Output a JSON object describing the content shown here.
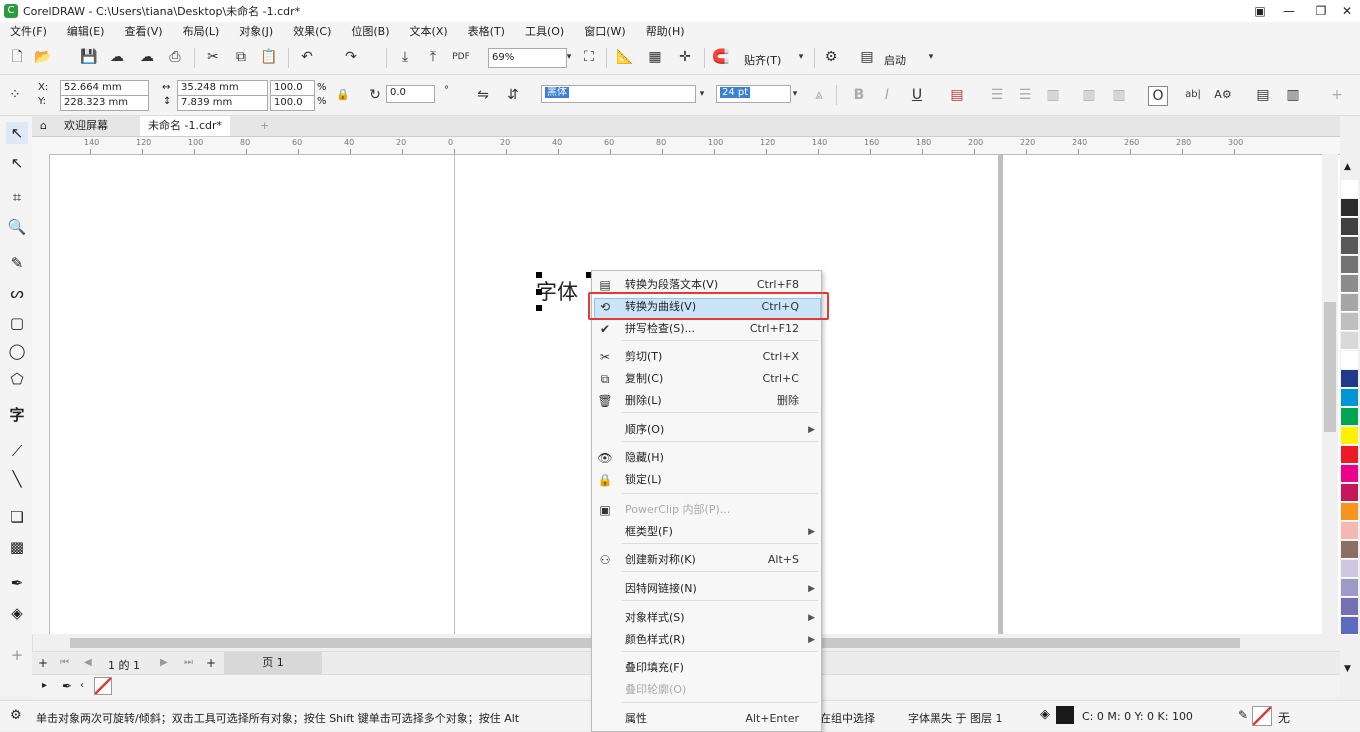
{
  "window": {
    "title": "CorelDRAW - C:\\Users\\tiana\\Desktop\\未命名 -1.cdr*"
  },
  "menu": [
    "文件(F)",
    "编辑(E)",
    "查看(V)",
    "布局(L)",
    "对象(J)",
    "效果(C)",
    "位图(B)",
    "文本(X)",
    "表格(T)",
    "工具(O)",
    "窗口(W)",
    "帮助(H)"
  ],
  "toolbar": {
    "zoom": "69%",
    "snap_label": "贴齐(T)",
    "launch_label": "启动"
  },
  "props": {
    "x_label": "X:",
    "x": "52.664 mm",
    "y_label": "Y:",
    "y": "228.323 mm",
    "w": "35.248 mm",
    "h": "7.839 mm",
    "sx": "100.0",
    "sy": "100.0",
    "pct": "%",
    "angle": "0.0",
    "font": "黑体",
    "size": "24 pt"
  },
  "tabs": {
    "welcome": "欢迎屏幕",
    "doc": "未命名 -1.cdr*"
  },
  "ruler": [
    "140",
    "120",
    "100",
    "80",
    "60",
    "40",
    "20",
    "0",
    "20",
    "40",
    "60",
    "80",
    "100",
    "120",
    "140",
    "160",
    "180",
    "200",
    "220",
    "240",
    "260",
    "280",
    "300"
  ],
  "canvas_text": "字体",
  "context_menu": [
    {
      "icon": "paragraph-text-icon",
      "label": "转换为段落文本(V)",
      "shortcut": "Ctrl+F8"
    },
    {
      "icon": "curve-icon",
      "label": "转换为曲线(V)",
      "shortcut": "Ctrl+Q",
      "highlight": true
    },
    {
      "icon": "spellcheck-icon",
      "label": "拼写检查(S)...",
      "shortcut": "Ctrl+F12"
    },
    {
      "icon": "cut-icon",
      "label": "剪切(T)",
      "shortcut": "Ctrl+X"
    },
    {
      "icon": "copy-icon",
      "label": "复制(C)",
      "shortcut": "Ctrl+C"
    },
    {
      "icon": "trash-icon",
      "label": "删除(L)",
      "shortcut": "删除"
    },
    {
      "icon": "",
      "label": "顺序(O)",
      "arrow": true
    },
    {
      "icon": "eye-icon",
      "label": "隐藏(H)"
    },
    {
      "icon": "lock-icon",
      "label": "锁定(L)"
    },
    {
      "icon": "powerclip-icon",
      "label": "PowerClip 内部(P)...",
      "disabled": true
    },
    {
      "icon": "",
      "label": "框类型(F)",
      "arrow": true
    },
    {
      "icon": "symmetry-icon",
      "label": "创建新对称(K)",
      "shortcut": "Alt+S"
    },
    {
      "icon": "",
      "label": "因特网链接(N)",
      "arrow": true
    },
    {
      "icon": "",
      "label": "对象样式(S)",
      "arrow": true
    },
    {
      "icon": "",
      "label": "颜色样式(R)",
      "arrow": true
    },
    {
      "icon": "",
      "label": "叠印填充(F)"
    },
    {
      "icon": "",
      "label": "叠印轮廓(O)",
      "disabled": true
    },
    {
      "icon": "",
      "label": "属性",
      "shortcut": "Alt+Enter"
    }
  ],
  "pagebar": {
    "page_of": "1 的 1",
    "page_tab": "页 1"
  },
  "status": {
    "hint": "单击对象两次可旋转/倾斜；双击工具可选择所有对象；按住 Shift 键单击可选择多个对象；按住 Alt",
    "hint_tail": "在组中选择",
    "object": "字体黑失 于 图层 1",
    "cmyk": "C: 0 M: 0 Y: 0 K: 100",
    "outline": "无"
  },
  "palette": [
    "#ffffff",
    "#2b2b2b",
    "#404040",
    "#595959",
    "#737373",
    "#8c8c8c",
    "#a6a6a6",
    "#bfbfbf",
    "#d9d9d9",
    "#ffffff",
    "#1f3a8a",
    "#0096d6",
    "#00a651",
    "#fff200",
    "#ed1c24",
    "#ec008c",
    "#c2185b",
    "#f7941d",
    "#f5b7b1",
    "#8d6e63",
    "#cfc6e0",
    "#9e9ac8",
    "#7570b3",
    "#5c6bc0"
  ]
}
